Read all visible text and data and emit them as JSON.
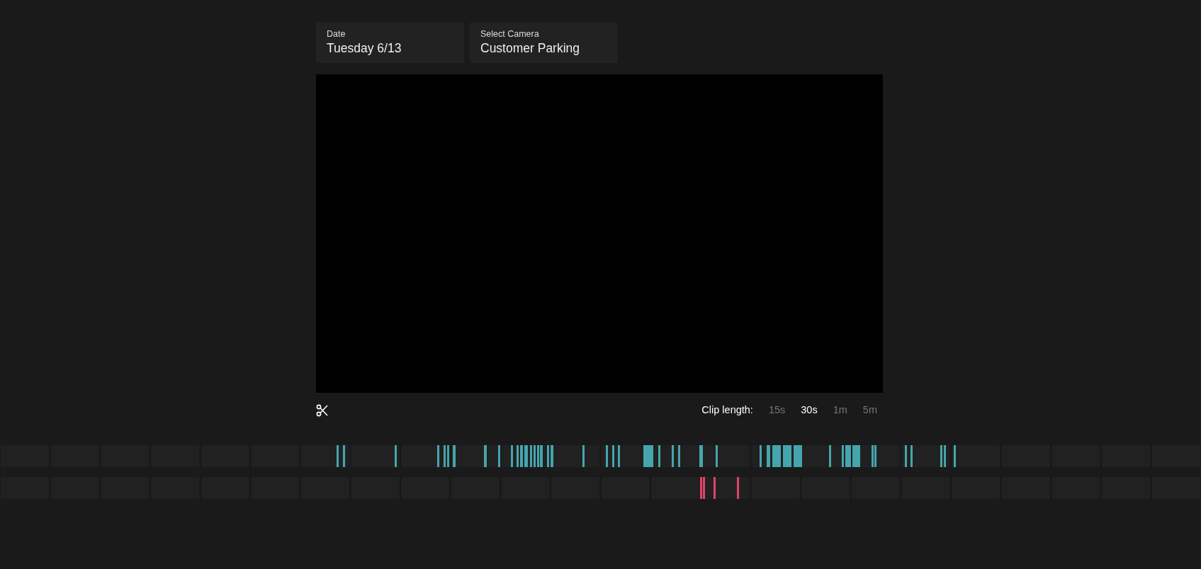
{
  "filters": [
    {
      "label": "Date",
      "value": "Tuesday 6/13"
    },
    {
      "label": "Select Camera",
      "value": "Customer Parking"
    }
  ],
  "player": {
    "kind": "empty"
  },
  "clip_length": {
    "label": "Clip length:",
    "options": [
      {
        "label": "15s",
        "selected": false
      },
      {
        "label": "30s",
        "selected": true
      },
      {
        "label": "1m",
        "selected": false
      },
      {
        "label": "5m",
        "selected": false
      }
    ]
  },
  "timeline": {
    "tracks": [
      {
        "color": "#45a5ad"
      },
      {
        "color": "#e0446a"
      }
    ]
  }
}
